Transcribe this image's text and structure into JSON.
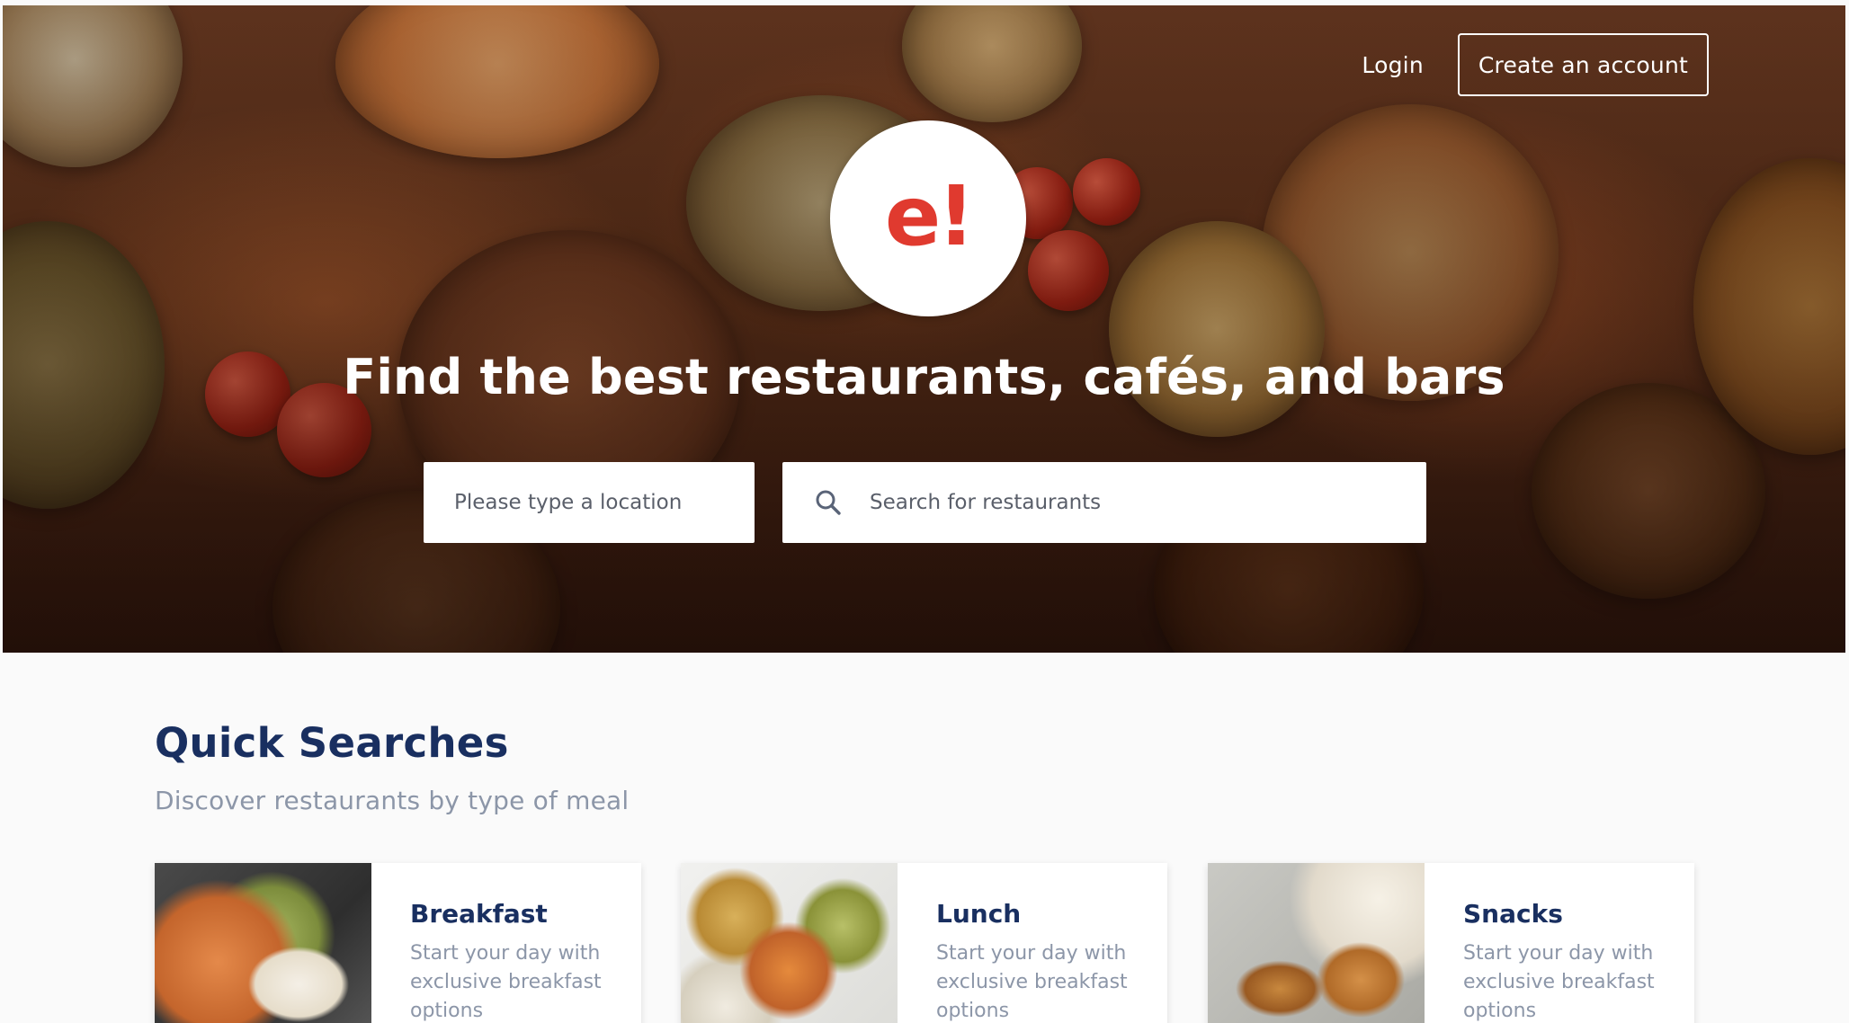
{
  "header": {
    "login_label": "Login",
    "create_account_label": "Create an account"
  },
  "hero": {
    "logo_text": "e!",
    "title": "Find the best restaurants, cafés, and bars",
    "location_placeholder": "Please type a location",
    "search_placeholder": "Search for restaurants",
    "search_icon": "search-icon"
  },
  "quick_searches": {
    "title": "Quick Searches",
    "subtitle": "Discover restaurants by type of meal",
    "cards": [
      {
        "title": "Breakfast",
        "description": "Start your day with exclusive breakfast options"
      },
      {
        "title": "Lunch",
        "description": "Start your day with exclusive breakfast options"
      },
      {
        "title": "Snacks",
        "description": "Start your day with exclusive breakfast options"
      }
    ]
  },
  "colors": {
    "brand_red": "#e03a2f",
    "heading_navy": "#192f60",
    "muted_text": "#8c96a8"
  }
}
